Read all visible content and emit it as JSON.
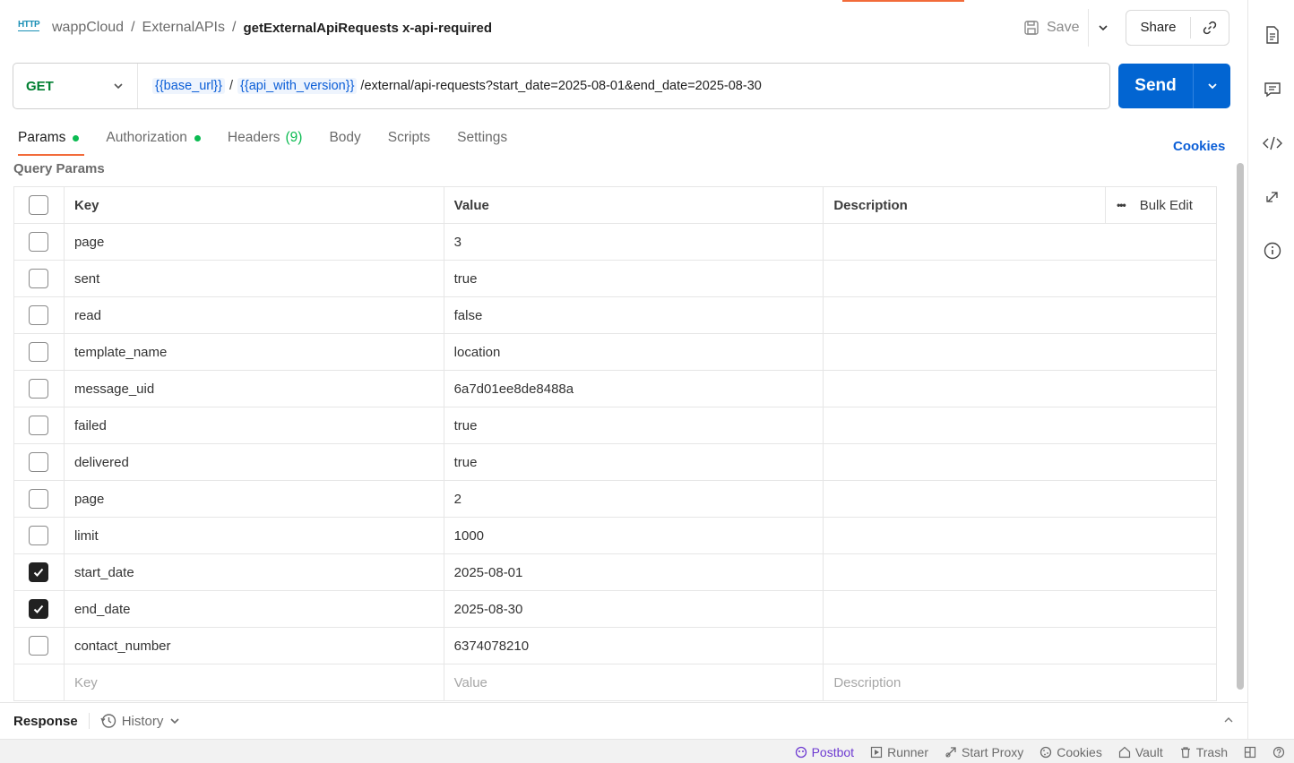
{
  "header": {
    "http_badge": "HTTP",
    "breadcrumb": [
      "wappCloud",
      "ExternalAPIs"
    ],
    "separator": "/",
    "request_name": "getExternalApiRequests x-api-required",
    "save_label": "Save",
    "share_label": "Share"
  },
  "url_bar": {
    "method": "GET",
    "var1": "{{base_url}}",
    "sep": "/",
    "var2": "{{api_with_version}}",
    "path": "/external/api-requests?start_date=2025-08-01&end_date=2025-08-30",
    "send_label": "Send"
  },
  "tabs": {
    "params": "Params",
    "authorization": "Authorization",
    "headers": "Headers",
    "headers_count": "(9)",
    "body": "Body",
    "scripts": "Scripts",
    "settings": "Settings",
    "cookies": "Cookies"
  },
  "query_params": {
    "title": "Query Params",
    "columns": {
      "key": "Key",
      "value": "Value",
      "description": "Description",
      "bulk_edit": "Bulk Edit"
    },
    "rows": [
      {
        "key": "page",
        "value": "3",
        "checked": false
      },
      {
        "key": "sent",
        "value": "true",
        "checked": false
      },
      {
        "key": "read",
        "value": "false",
        "checked": false
      },
      {
        "key": "template_name",
        "value": "location",
        "checked": false
      },
      {
        "key": "message_uid",
        "value": "6a7d01ee8de8488a",
        "checked": false
      },
      {
        "key": "failed",
        "value": "true",
        "checked": false
      },
      {
        "key": "delivered",
        "value": "true",
        "checked": false
      },
      {
        "key": "page",
        "value": "2",
        "checked": false
      },
      {
        "key": "limit",
        "value": "1000",
        "checked": false
      },
      {
        "key": "start_date",
        "value": "2025-08-01",
        "checked": true
      },
      {
        "key": "end_date",
        "value": "2025-08-30",
        "checked": true
      },
      {
        "key": "contact_number",
        "value": "6374078210",
        "checked": false
      }
    ],
    "placeholder": {
      "key": "Key",
      "value": "Value",
      "description": "Description"
    }
  },
  "response": {
    "label": "Response",
    "history": "History"
  },
  "statusbar": {
    "postbot": "Postbot",
    "runner": "Runner",
    "start_proxy": "Start Proxy",
    "cookies": "Cookies",
    "vault": "Vault",
    "trash": "Trash"
  },
  "colors": {
    "accent": "#f26b3a",
    "primary": "#0265d2",
    "method_get": "#007f31",
    "status_dot": "#0cbb52"
  }
}
